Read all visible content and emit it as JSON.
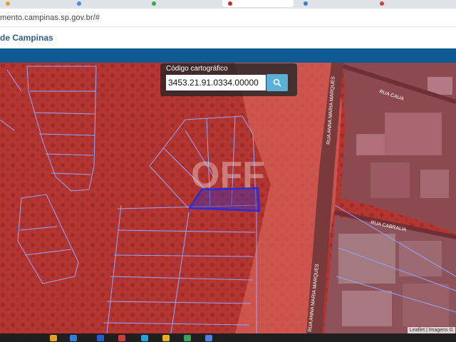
{
  "browser": {
    "url": "mento.campinas.sp.gov.br/#"
  },
  "site": {
    "title": "de Campinas"
  },
  "search": {
    "label": "Código cartográfico",
    "value": "3453.21.91.0334.00000"
  },
  "map": {
    "streets": [
      {
        "name": "RUA CAUA"
      },
      {
        "name": "RUA ANNA MARIA MARQUES"
      },
      {
        "name": "RUA CABRALIA"
      },
      {
        "name": "RUA ANNA MARIA MARQUES"
      }
    ],
    "watermark": "OFF",
    "attribution": "Leaflet | Imagens G",
    "colors": {
      "overlay": "#c0392b",
      "parcel_lines": "#8fa8ff",
      "selected_parcel": "#2b2bd6"
    }
  },
  "icons": {
    "search_button": "search-icon"
  }
}
